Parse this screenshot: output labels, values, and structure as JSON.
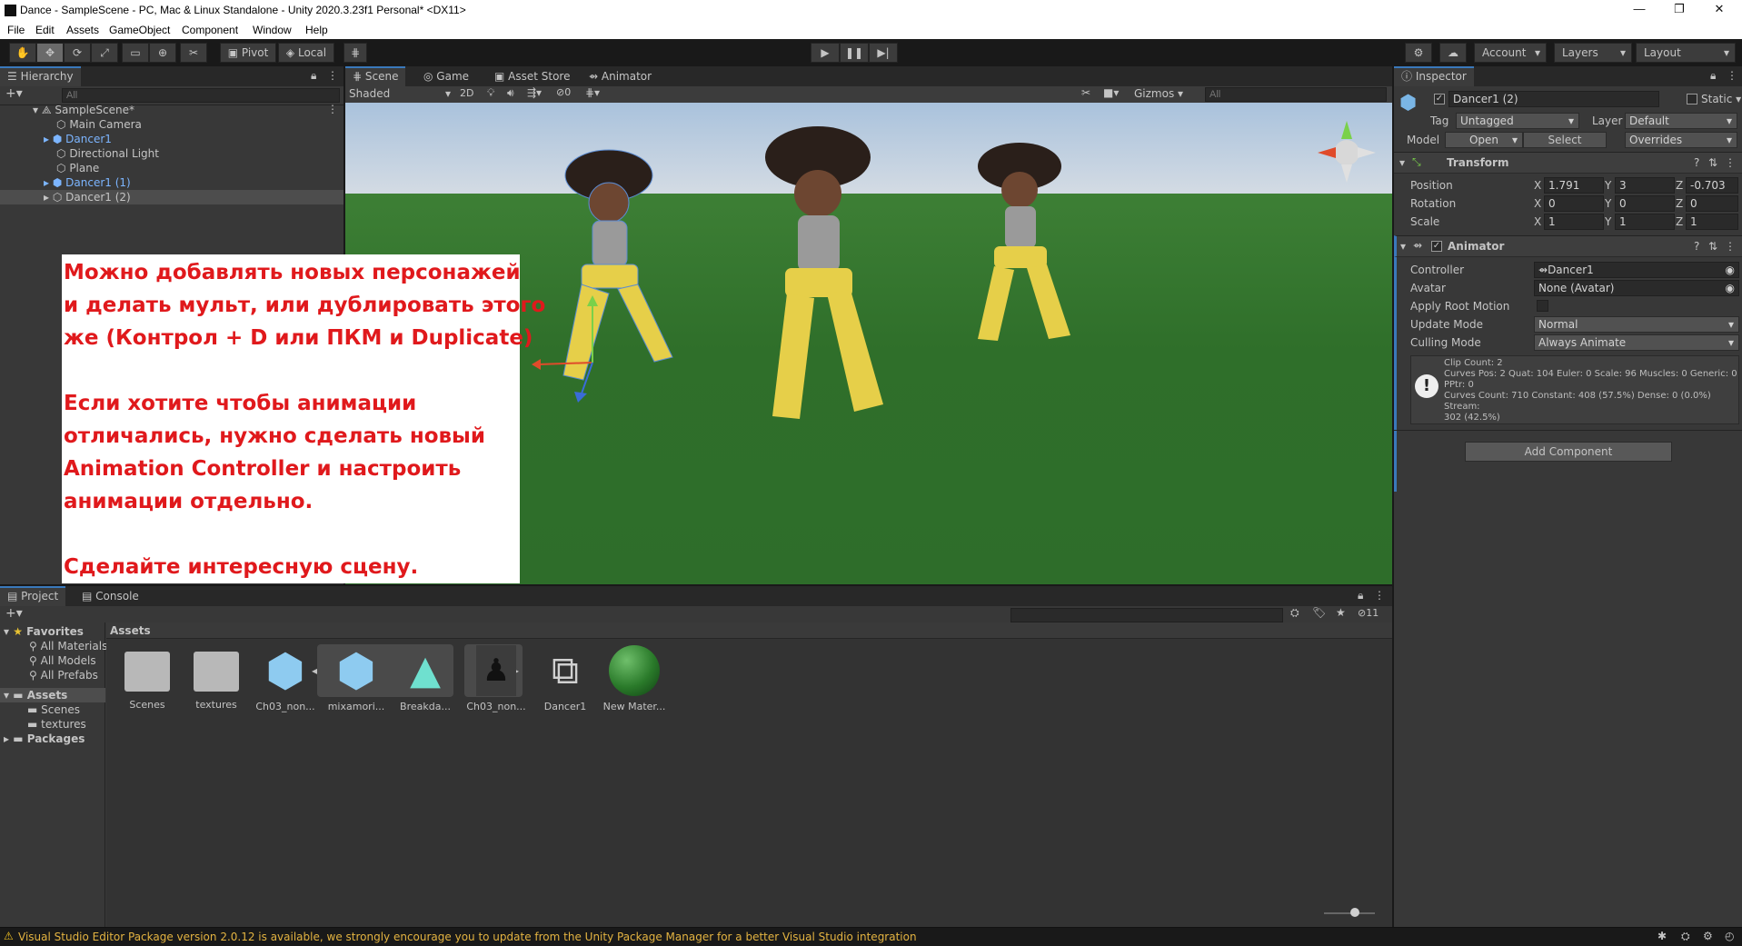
{
  "window": {
    "title": "Dance - SampleScene - PC, Mac & Linux Standalone - Unity 2020.3.23f1 Personal* <DX11>"
  },
  "menu": [
    "File",
    "Edit",
    "Assets",
    "GameObject",
    "Component",
    "Window",
    "Help"
  ],
  "toolbar": {
    "pivot": "Pivot",
    "local": "Local",
    "account": "Account",
    "layers": "Layers",
    "layout": "Layout"
  },
  "hierarchy": {
    "tab": "Hierarchy",
    "search_placeholder": "All",
    "scene": "SampleScene*",
    "items": [
      {
        "label": "Main Camera",
        "prefab": false
      },
      {
        "label": "Dancer1",
        "prefab": true
      },
      {
        "label": "Directional Light",
        "prefab": false
      },
      {
        "label": "Plane",
        "prefab": false
      },
      {
        "label": "Dancer1 (1)",
        "prefab": true
      },
      {
        "label": "Dancer1 (2)",
        "prefab": false
      }
    ]
  },
  "scene": {
    "tabs": [
      "Scene",
      "Game",
      "Asset Store",
      "Animator"
    ],
    "shading": "Shaded",
    "mode_2d": "2D",
    "hidden_count": "0",
    "gizmos": "Gizmos",
    "search_placeholder": "All",
    "annotation": [
      "Можно добавлять новых персонажей",
      "и делать мульт, или дублировать этого",
      "же (Контрол + D или ПКМ и Duplicate)",
      "",
      "Если хотите чтобы анимации",
      "отличались, нужно сделать новый",
      "Animation Controller и настроить",
      "анимации отдельно.",
      "",
      "Сделайте интересную сцену."
    ]
  },
  "inspector": {
    "tab": "Inspector",
    "object_name": "Dancer1 (2)",
    "static": "Static",
    "tag_label": "Tag",
    "tag": "Untagged",
    "layer_label": "Layer",
    "layer": "Default",
    "model_label": "Model",
    "open": "Open",
    "select": "Select",
    "overrides": "Overrides",
    "transform": {
      "title": "Transform",
      "position_label": "Position",
      "rotation_label": "Rotation",
      "scale_label": "Scale",
      "position": [
        "1.791",
        "3",
        "-0.703"
      ],
      "rotation": [
        "0",
        "0",
        "0"
      ],
      "scale": [
        "1",
        "1",
        "1"
      ]
    },
    "animator": {
      "title": "Animator",
      "controller_label": "Controller",
      "controller": "Dancer1",
      "avatar_label": "Avatar",
      "avatar": "None (Avatar)",
      "root_motion_label": "Apply Root Motion",
      "update_mode_label": "Update Mode",
      "update_mode": "Normal",
      "culling_label": "Culling Mode",
      "culling": "Always Animate",
      "info": [
        "Clip Count: 2",
        "Curves Pos: 2 Quat: 104 Euler: 0 Scale: 96 Muscles: 0 Generic: 0",
        "PPtr: 0",
        "Curves Count: 710 Constant: 408 (57.5%) Dense: 0 (0.0%) Stream:",
        "302 (42.5%)"
      ]
    },
    "add_component": "Add Component"
  },
  "project": {
    "tabs": [
      "Project",
      "Console"
    ],
    "favorites": "Favorites",
    "fav_items": [
      "All Materials",
      "All Models",
      "All Prefabs"
    ],
    "assets_label": "Assets",
    "asset_folders": [
      "Scenes",
      "textures"
    ],
    "packages": "Packages",
    "breadcrumb": "Assets",
    "hidden_count": "11",
    "assets": [
      {
        "name": "Scenes",
        "icon": "folder-icon"
      },
      {
        "name": "textures",
        "icon": "folder-icon"
      },
      {
        "name": "Ch03_non...",
        "icon": "model-prefab-icon"
      },
      {
        "name": "mixamori...",
        "icon": "model-prefab-icon"
      },
      {
        "name": "Breakda...",
        "icon": "animation-clip-icon"
      },
      {
        "name": "Ch03_non...",
        "icon": "avatar-preview-icon"
      },
      {
        "name": "Dancer1",
        "icon": "animator-controller-icon"
      },
      {
        "name": "New Mater...",
        "icon": "material-sphere-icon"
      }
    ]
  },
  "status": {
    "message": "Visual Studio Editor Package version 2.0.12 is available, we strongly encourage you to update from the Unity Package Manager for a better Visual Studio integration"
  }
}
